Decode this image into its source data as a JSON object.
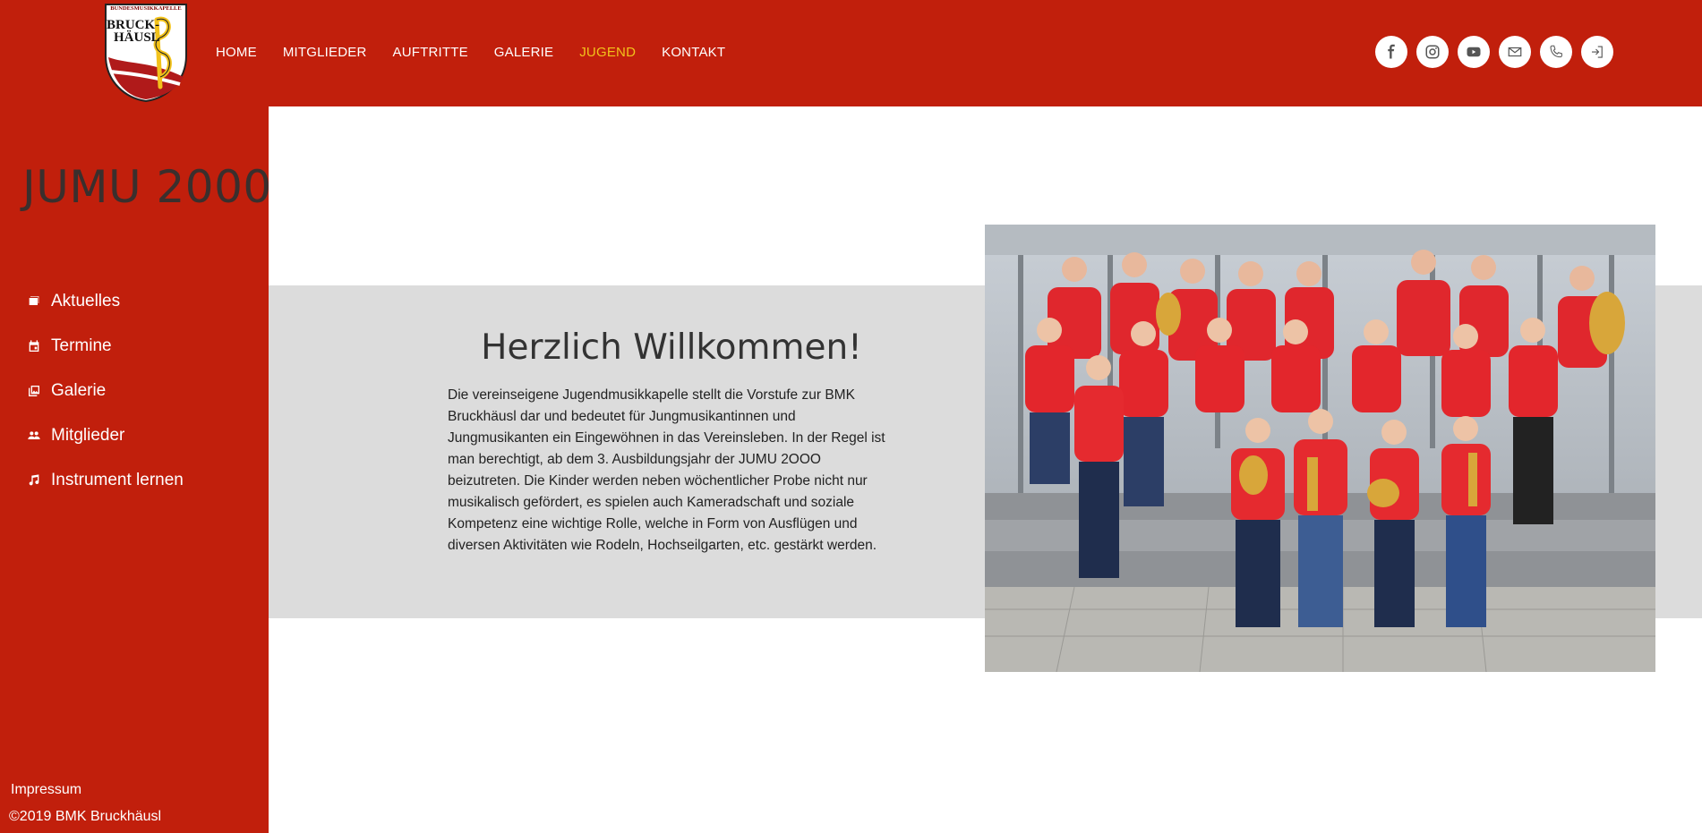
{
  "header": {
    "logo": {
      "top_text": "BUNDESMUSIKKAPELLE",
      "line1": "BRUCK-",
      "line2": "HÄUSL"
    },
    "nav": [
      {
        "label": "HOME"
      },
      {
        "label": "MITGLIEDER"
      },
      {
        "label": "AUFTRITTE"
      },
      {
        "label": "GALERIE"
      },
      {
        "label": "JUGEND",
        "active": true
      },
      {
        "label": "KONTAKT"
      }
    ],
    "socials": [
      "facebook-icon",
      "instagram-icon",
      "youtube-icon",
      "mail-icon",
      "phone-icon",
      "login-icon"
    ]
  },
  "sidebar": {
    "title": "JUMU 2000",
    "items": [
      {
        "label": "Aktuelles",
        "icon": "news-icon"
      },
      {
        "label": "Termine",
        "icon": "calendar-icon"
      },
      {
        "label": "Galerie",
        "icon": "gallery-icon"
      },
      {
        "label": "Mitglieder",
        "icon": "people-icon"
      },
      {
        "label": "Instrument lernen",
        "icon": "music-note-icon"
      }
    ],
    "impressum": "Impressum",
    "copyright": "©2019 BMK Bruckhäusl"
  },
  "main": {
    "title": "Herzlich Willkommen!",
    "text": "Die vereinseigene Jugendmusikkapelle stellt die Vorstufe zur BMK Bruckhäusl dar und bedeutet für Jungmusikantinnen und Jungmusikanten ein Eingewöhnen in das Vereinsleben. In der Regel ist man berechtigt, ab dem 3. Ausbildungsjahr der JUMU 2OOO beizutreten. Die Kinder werden neben wöchentlicher Probe nicht nur musikalisch gefördert, es spielen auch Kameradschaft und soziale Kompetenz eine wichtige Rolle, welche in Form von Ausflügen und diversen Aktivitäten wie Rodeln, Hochseilgarten, etc. gestärkt werden."
  },
  "colors": {
    "brand_red": "#c11f0c",
    "active_nav": "#f2c21b",
    "band_grey": "#dcdcdc"
  }
}
